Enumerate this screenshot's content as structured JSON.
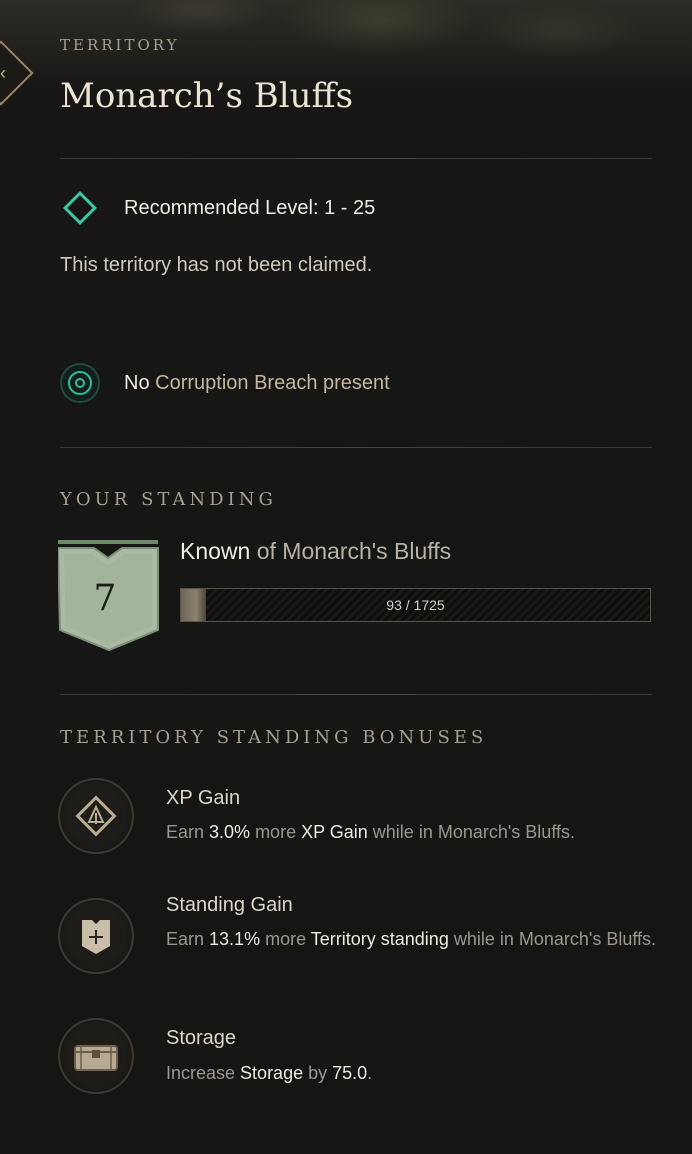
{
  "header": {
    "eyebrow": "TERRITORY",
    "title": "Monarch’s Bluffs"
  },
  "info": {
    "recommended_level": "Recommended Level: 1 - 25",
    "claim_status": "This territory has not been claimed.",
    "breach_prefix": "No",
    "breach_text": " Corruption Breach present"
  },
  "standing": {
    "heading": "YOUR STANDING",
    "rank": "7",
    "rank_label_strong": "Known",
    "rank_label_rest": " of Monarch's Bluffs",
    "progress_text": "93 / 1725",
    "progress_current": 93,
    "progress_max": 1725
  },
  "bonuses": {
    "heading": "TERRITORY STANDING BONUSES",
    "items": [
      {
        "title": "XP Gain",
        "icon": "xp-gain-icon",
        "d1": "Earn ",
        "v1": "3.0%",
        "d2": " more ",
        "v2": "XP Gain",
        "d3": " while in Monarch's Bluffs."
      },
      {
        "title": "Standing Gain",
        "icon": "standing-gain-icon",
        "d1": "Earn ",
        "v1": "13.1%",
        "d2": " more ",
        "v2": "Territory standing",
        "d3": " while in Monarch's Bluffs."
      },
      {
        "title": "Storage",
        "icon": "storage-chest-icon",
        "d1": "Increase ",
        "v1": "Storage",
        "d2": " by ",
        "v2": "75.0",
        "d3": "."
      }
    ]
  },
  "colors": {
    "accent_teal": "#39c9a7",
    "gold_trim": "#9a8560",
    "shield_green": "#a9b9a3"
  }
}
